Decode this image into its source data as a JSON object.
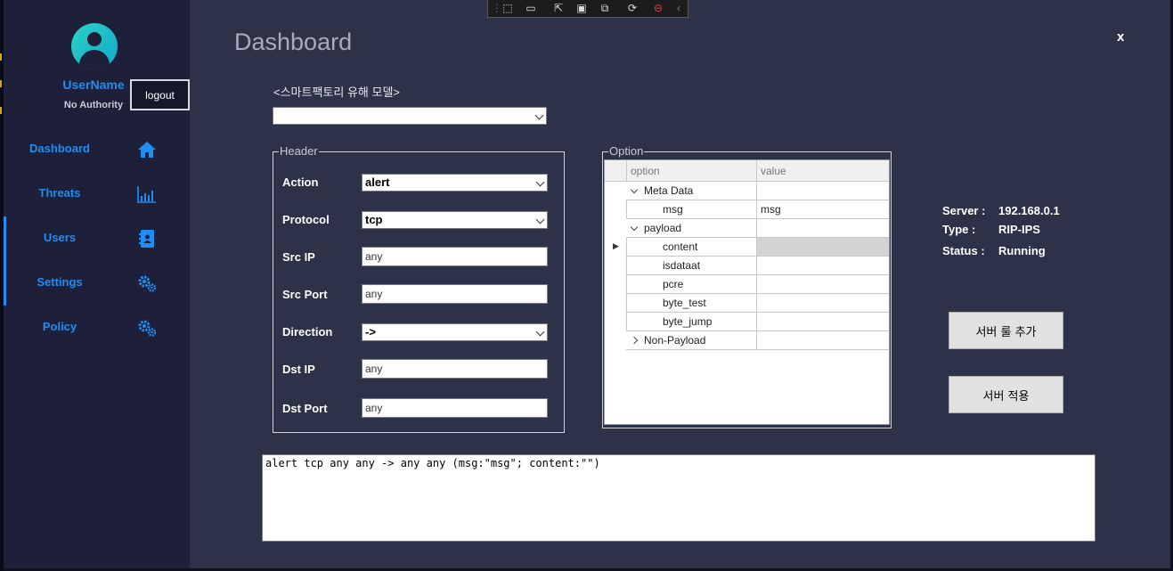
{
  "user": {
    "name": "UserName",
    "authority": "No Authority",
    "logout_label": "logout"
  },
  "nav": [
    {
      "label": "Dashboard",
      "icon": "home-icon"
    },
    {
      "label": "Threats",
      "icon": "bar-chart-icon"
    },
    {
      "label": "Users",
      "icon": "address-book-icon"
    },
    {
      "label": "Settings",
      "icon": "gears-icon"
    },
    {
      "label": "Policy",
      "icon": "gears-icon"
    }
  ],
  "page": {
    "title": "Dashboard",
    "close_label": "x"
  },
  "model": {
    "label": "<스마트팩토리 유해 모델>",
    "selected": ""
  },
  "header": {
    "legend": "Header",
    "fields": {
      "action": {
        "label": "Action",
        "value": "alert"
      },
      "protocol": {
        "label": "Protocol",
        "value": "tcp"
      },
      "src_ip": {
        "label": "Src IP",
        "value": "any"
      },
      "src_port": {
        "label": "Src Port",
        "value": "any"
      },
      "direction": {
        "label": "Direction",
        "value": "->"
      },
      "dst_ip": {
        "label": "Dst IP",
        "value": "any"
      },
      "dst_port": {
        "label": "Dst Port",
        "value": "any"
      }
    }
  },
  "option": {
    "legend": "Option",
    "columns": [
      "option",
      "value"
    ],
    "rows": [
      {
        "name": "Meta Data",
        "value": ""
      },
      {
        "name": "msg",
        "value": "msg"
      },
      {
        "name": "payload",
        "value": ""
      },
      {
        "name": "content",
        "value": ""
      },
      {
        "name": "isdataat",
        "value": ""
      },
      {
        "name": "pcre",
        "value": ""
      },
      {
        "name": "byte_test",
        "value": ""
      },
      {
        "name": "byte_jump",
        "value": ""
      },
      {
        "name": "Non-Payload",
        "value": ""
      }
    ]
  },
  "server": {
    "server_label": "Server :",
    "server_value": "192.168.0.1",
    "type_label": "Type :",
    "type_value": "RIP-IPS",
    "status_label": "Status :",
    "status_value": "Running"
  },
  "buttons": {
    "add_rule": "서버 룰 추가",
    "apply": "서버 적용"
  },
  "rule_text": "alert tcp any any -> any any (msg:\"msg\"; content:\"\")",
  "colors": {
    "accent": "#1e8ef2",
    "sidebar": "#1d2038",
    "main": "#2e3248"
  }
}
